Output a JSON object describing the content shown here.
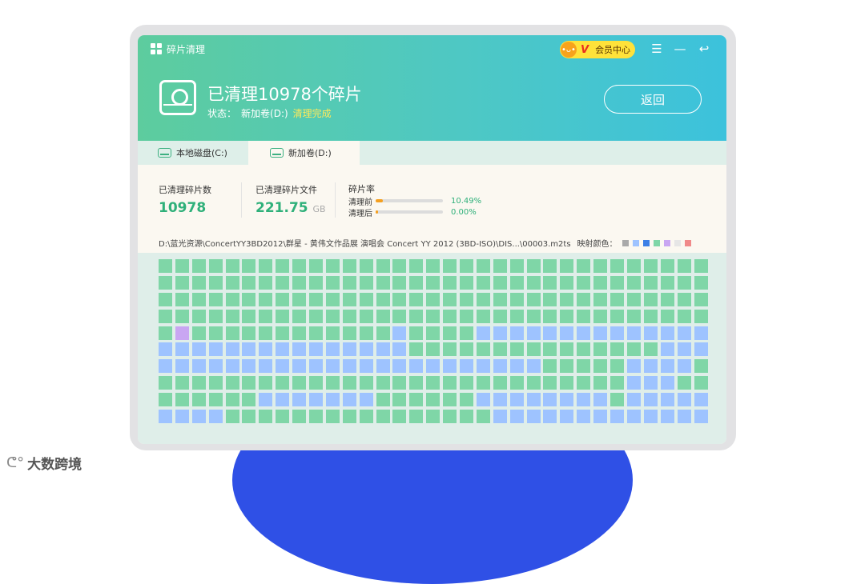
{
  "app": {
    "title": "碎片清理"
  },
  "vip": {
    "label": "会员中心",
    "v": "V"
  },
  "header": {
    "headline": "已清理10978个碎片",
    "status_label": "状态：",
    "volume": "新加卷(D:)",
    "status_done": "清理完成",
    "back_button": "返回"
  },
  "tabs": [
    {
      "label": "本地磁盘(C:)",
      "active": false
    },
    {
      "label": "新加卷(D:)",
      "active": true
    }
  ],
  "stats": {
    "cleaned_count_label": "已清理碎片数",
    "cleaned_count": "10978",
    "cleaned_files_label": "已清理碎片文件",
    "cleaned_files": "221.75",
    "cleaned_files_unit": "GB",
    "rate_label": "碎片率",
    "before_label": "清理前",
    "before_pct": "10.49%",
    "before_fraction": 0.1049,
    "after_label": "清理后",
    "after_pct": "0.00%",
    "after_fraction": 0.0
  },
  "path": "D:\\蓝光资源\\ConcertYY3BD2012\\群星 - 黄伟文作品展 演唱会 Concert YY 2012 (3BD-ISO)\\DIS...\\00003.m2ts",
  "legend_label": "映射颜色：",
  "legend_colors": [
    "#a9a9a9",
    "#9ec3ff",
    "#3c7fe6",
    "#7fd6a7",
    "#c9a6f2",
    "#e6e6e6",
    "#f08a8a"
  ],
  "colors": {
    "g": "#7fd6a7",
    "b": "#9ec3ff",
    "p": "#c9a6f2"
  },
  "cluster_rows": [
    "ggggggggggggggggggggggggggggggggg",
    "ggggggggggggggggggggggggggggggggg",
    "ggggggggggggggggggggggggggggggggg",
    "ggggggggggggggggggggggggggggggggg",
    "gpggggggggggggbggggbbbbbbbbbbbbbb",
    "bbbbbbbbbbbbbbbgggggggggggggggbbb",
    "bbbbbbbbbbbbbbbbbbbbbbbgggggbbbbg",
    "ggggggggggggggggggggggggggggbbbgg",
    "ggggggbbbbbbbggggggbbbbbbbbgbbbbb",
    "bbbbggggggggggggggggbbbbbbbbbbbbb"
  ],
  "brand": {
    "name": "大数跨境"
  }
}
